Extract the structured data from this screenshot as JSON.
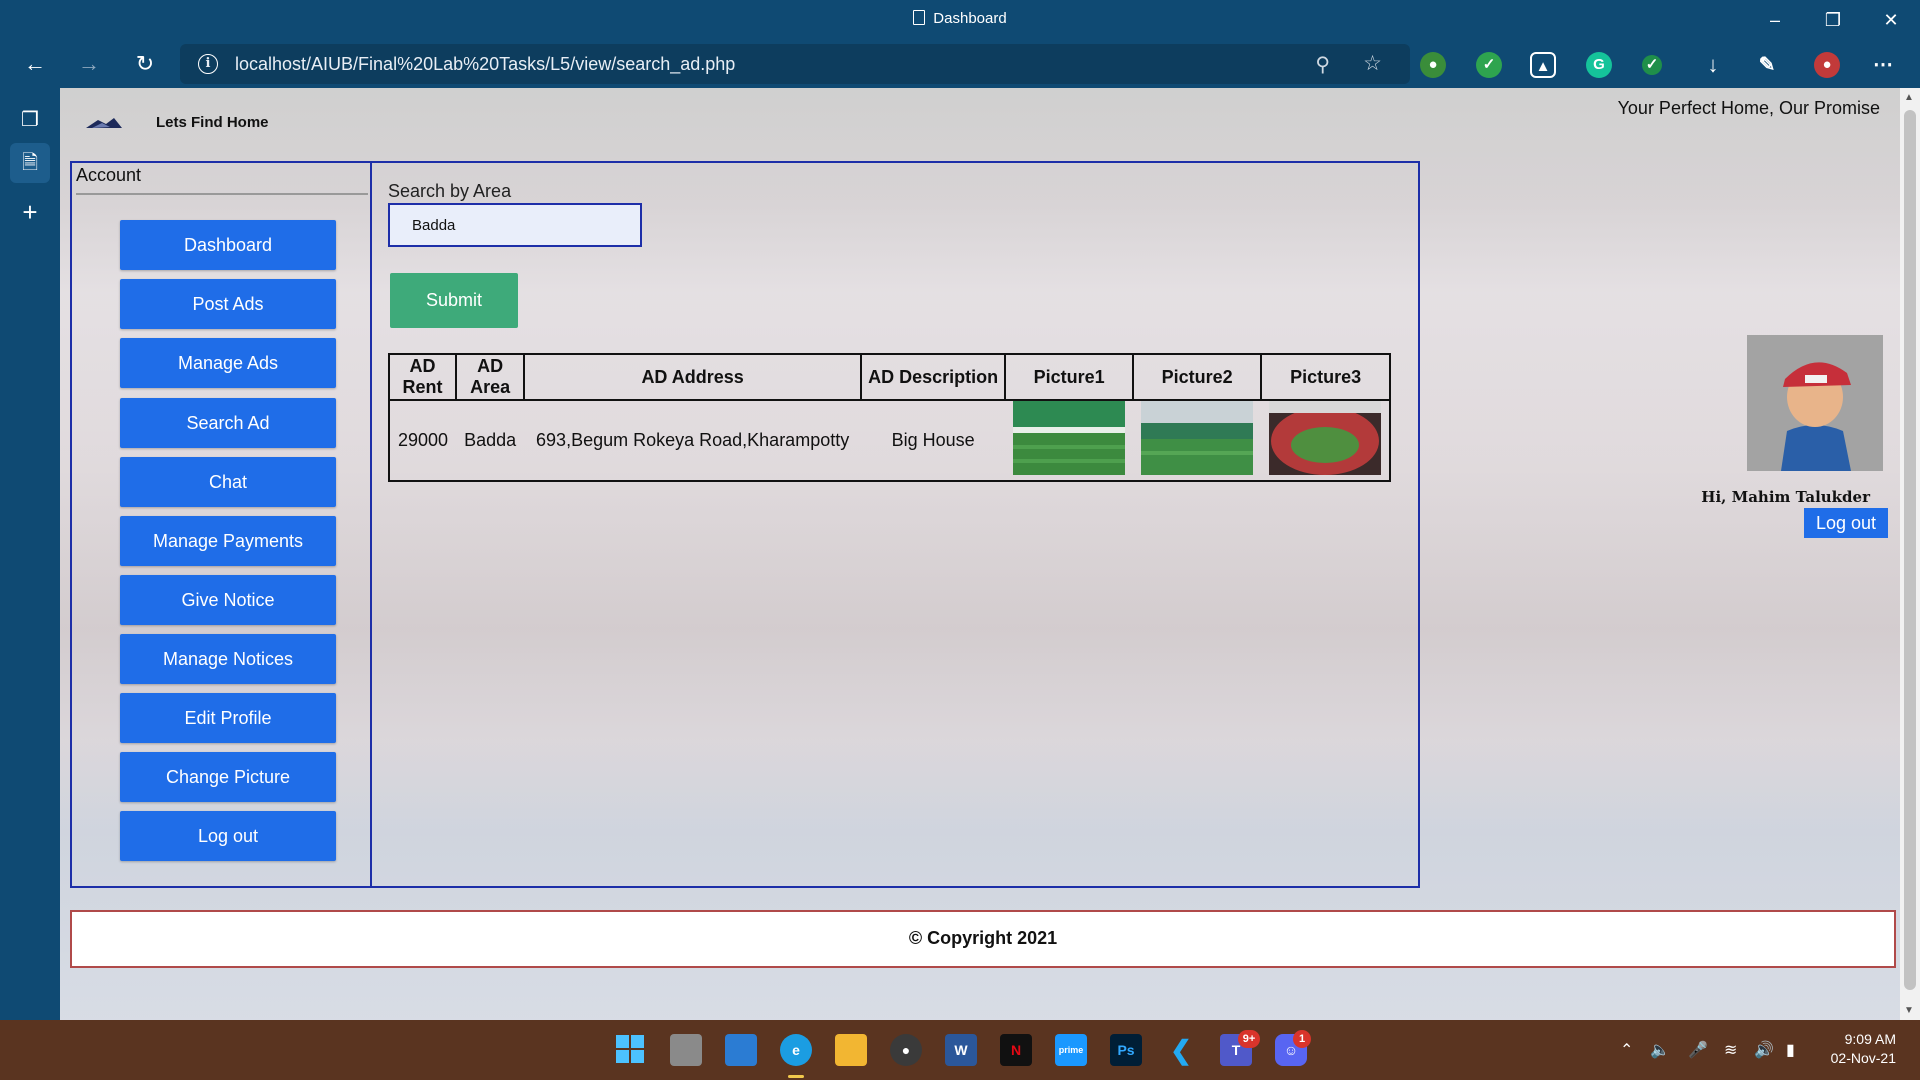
{
  "window": {
    "title": "Dashboard"
  },
  "browser": {
    "url": "localhost/AIUB/Final%20Lab%20Tasks/L5/view/search_ad.php"
  },
  "site": {
    "brand": "Lets Find Home",
    "tagline": "Your Perfect Home, Our Promise"
  },
  "sidebar": {
    "title": "Account",
    "items": [
      "Dashboard",
      "Post Ads",
      "Manage Ads",
      "Search Ad",
      "Chat",
      "Manage Payments",
      "Give Notice",
      "Manage Notices",
      "Edit Profile",
      "Change Picture",
      "Log out"
    ]
  },
  "search": {
    "label": "Search by Area",
    "value": "Badda",
    "submit_label": "Submit"
  },
  "table": {
    "headers": [
      "AD Rent",
      "AD Area",
      "AD Address",
      "AD Description",
      "Picture1",
      "Picture2",
      "Picture3"
    ],
    "rows": [
      {
        "rent": "29000",
        "area": "Badda",
        "address": "693,Begum Rokeya Road,Kharampotty",
        "description": "Big House"
      }
    ]
  },
  "user": {
    "greeting": "Hi, Mahim Talukder",
    "logout_label": "Log out"
  },
  "footer": {
    "text": "© Copyright 2021"
  },
  "taskbar": {
    "time": "9:09 AM",
    "date": "02-Nov-21",
    "teams_badge": "9+",
    "discord_badge": "1"
  },
  "colors": {
    "accent_blue": "#1f6de8",
    "submit_green": "#3eaa7a",
    "frame_border": "#1d2ea8",
    "chrome": "#0f4a73"
  }
}
